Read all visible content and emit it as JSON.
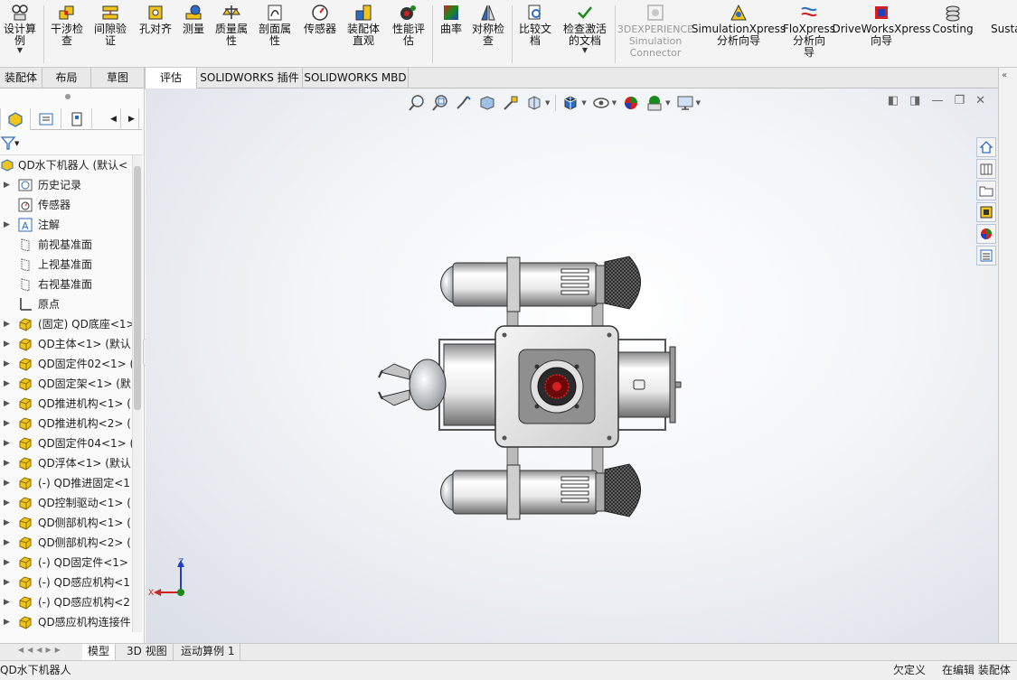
{
  "toolbar": {
    "design_study": "设计算\n例",
    "interference": "干涉检\n查",
    "clearance": "间隙验\n证",
    "hole_align": "孔对齐",
    "measure": "测量",
    "mass_props": "质量属\n性",
    "section_props": "剖面属\n性",
    "sensor": "传感器",
    "assembly_vis": "装配体\n直观",
    "perf_eval": "性能评\n估",
    "curvature": "曲率",
    "symmetry": "对称检\n查",
    "compare_docs": "比较文\n档",
    "check_active": "检查激活\n的文档",
    "sim_connector": "3DEXPERIENCE\nSimulation\nConnector",
    "simxpress": "SimulationXpress\n分析向导",
    "floxpress": "FloXpress\n分析向\n导",
    "driveworks": "DriveWorksXpress\n向导",
    "costing": "Costing",
    "sustain": "Susta"
  },
  "tabs": [
    "装配体",
    "布局",
    "草图",
    "评估",
    "SOLIDWORKS 插件",
    "SOLIDWORKS MBD"
  ],
  "active_tab": "评估",
  "tree": {
    "root": "QD水下机器人 (默认<",
    "items": [
      {
        "label": "历史记录",
        "arrow": "▶",
        "icon": "history-icon"
      },
      {
        "label": "传感器",
        "arrow": "",
        "icon": "sensor-icon"
      },
      {
        "label": "注解",
        "arrow": "▶",
        "icon": "annotation-icon"
      },
      {
        "label": "前视基准面",
        "arrow": "",
        "icon": "plane-icon"
      },
      {
        "label": "上视基准面",
        "arrow": "",
        "icon": "plane-icon"
      },
      {
        "label": "右视基准面",
        "arrow": "",
        "icon": "plane-icon"
      },
      {
        "label": "原点",
        "arrow": "",
        "icon": "origin-icon"
      },
      {
        "label": "(固定) QD底座<1>",
        "arrow": "▶",
        "icon": "part-icon"
      },
      {
        "label": "QD主体<1> (默认",
        "arrow": "▶",
        "icon": "part-icon"
      },
      {
        "label": "QD固定件02<1> (",
        "arrow": "▶",
        "icon": "part-icon"
      },
      {
        "label": "QD固定架<1> (默",
        "arrow": "▶",
        "icon": "part-icon"
      },
      {
        "label": "QD推进机构<1> (",
        "arrow": "▶",
        "icon": "part-icon"
      },
      {
        "label": "QD推进机构<2> (",
        "arrow": "▶",
        "icon": "part-icon"
      },
      {
        "label": "QD固定件04<1> (",
        "arrow": "▶",
        "icon": "part-icon"
      },
      {
        "label": "QD浮体<1> (默认",
        "arrow": "▶",
        "icon": "part-icon"
      },
      {
        "label": "(-) QD推进固定<1",
        "arrow": "▶",
        "icon": "part-icon"
      },
      {
        "label": "QD控制驱动<1> (",
        "arrow": "▶",
        "icon": "part-icon"
      },
      {
        "label": "QD侧部机构<1> (",
        "arrow": "▶",
        "icon": "part-icon"
      },
      {
        "label": "QD侧部机构<2> (",
        "arrow": "▶",
        "icon": "part-icon"
      },
      {
        "label": "(-) QD固定件<1>",
        "arrow": "▶",
        "icon": "part-icon"
      },
      {
        "label": "(-) QD感应机构<1",
        "arrow": "▶",
        "icon": "part-icon"
      },
      {
        "label": "(-) QD感应机构<2",
        "arrow": "▶",
        "icon": "part-icon"
      },
      {
        "label": "QD感应机构连接件",
        "arrow": "▶",
        "icon": "part-icon"
      }
    ]
  },
  "bottom_tabs": [
    "模型",
    "3D 视图",
    "运动算例 1"
  ],
  "status": {
    "doc_name": "QD水下机器人",
    "definition": "欠定义",
    "mode": "在编辑 装配体"
  },
  "triad": {
    "z": "Z",
    "x": "X"
  },
  "colors": {
    "accent": "#2b6cc4",
    "part_yellow": "#f0c418",
    "triad_red": "#d42020",
    "triad_green": "#1a8a1a",
    "triad_blue": "#2040c0"
  }
}
